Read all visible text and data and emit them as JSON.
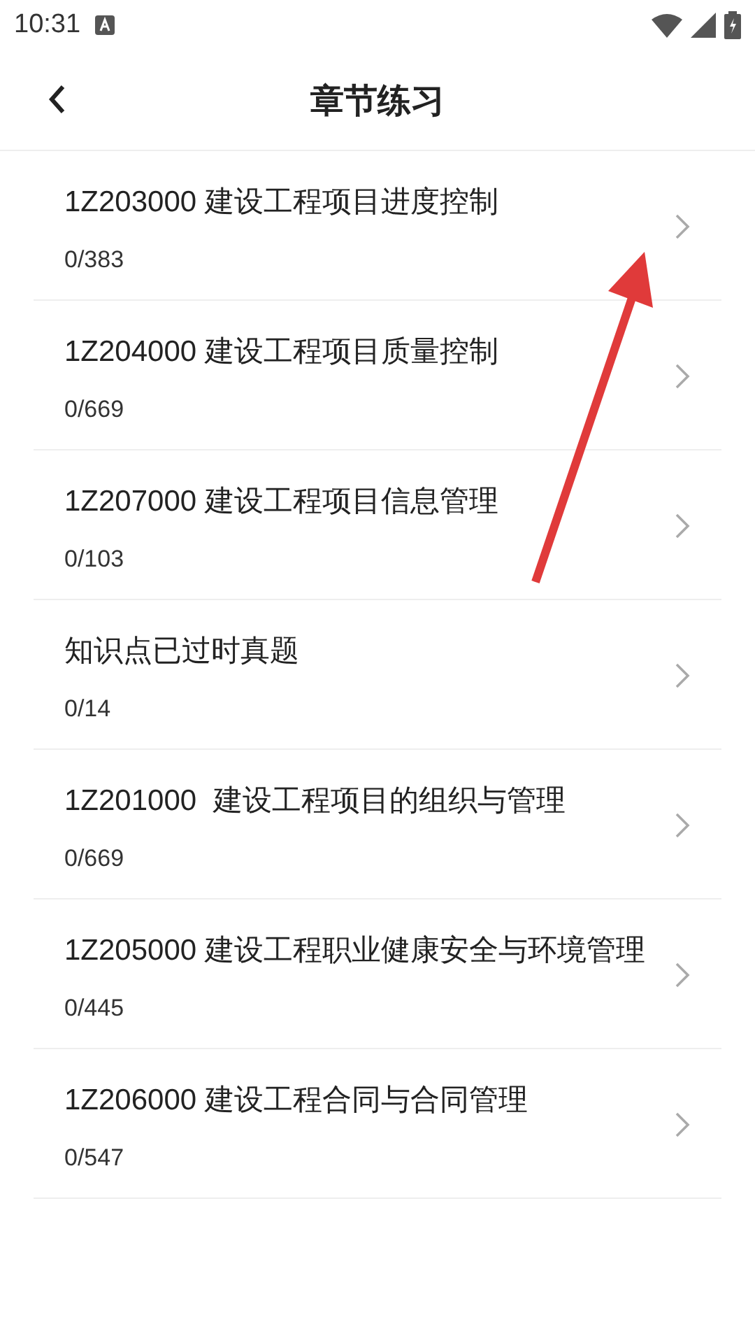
{
  "status_bar": {
    "time": "10:31"
  },
  "header": {
    "title": "章节练习"
  },
  "chapters": [
    {
      "title": "1Z203000 建设工程项目进度控制",
      "count": "0/383"
    },
    {
      "title": "1Z204000 建设工程项目质量控制",
      "count": "0/669"
    },
    {
      "title": "1Z207000 建设工程项目信息管理",
      "count": "0/103"
    },
    {
      "title": "知识点已过时真题",
      "count": "0/14"
    },
    {
      "title": "1Z201000  建设工程项目的组织与管理",
      "count": "0/669"
    },
    {
      "title": "1Z205000 建设工程职业健康安全与环境管理",
      "count": "0/445"
    },
    {
      "title": "1Z206000 建设工程合同与合同管理",
      "count": "0/547"
    }
  ]
}
